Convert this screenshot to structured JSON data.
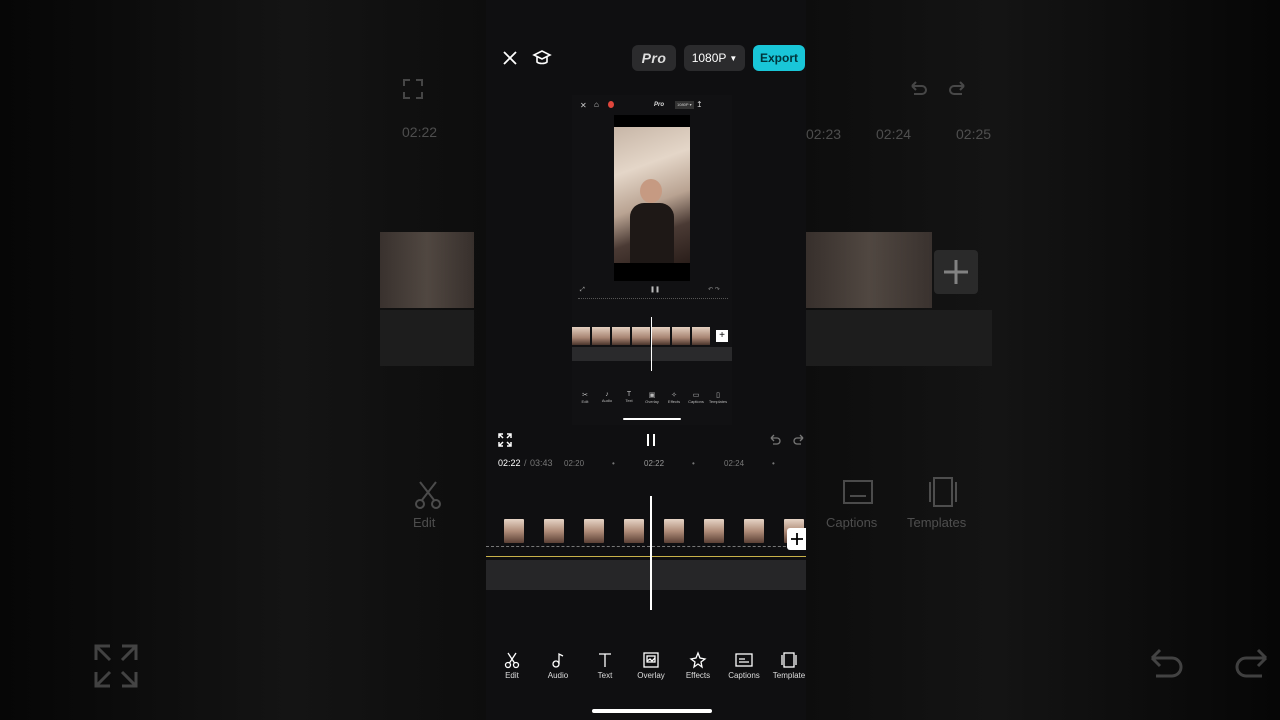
{
  "top_bar": {
    "close_label": "×",
    "pro_label": "Pro",
    "resolution_label": "1080P",
    "export_label": "Export"
  },
  "nested_preview": {
    "pro_label": "Pro",
    "resolution_label": "1080P"
  },
  "playback": {
    "current_time": "02:22",
    "separator": "/",
    "total_time": "03:43",
    "ticks": [
      "02:20",
      "02:22",
      "02:24"
    ]
  },
  "toolbar": {
    "items": [
      {
        "label": "Edit",
        "icon": "scissors-icon"
      },
      {
        "label": "Audio",
        "icon": "music-note-icon"
      },
      {
        "label": "Text",
        "icon": "text-icon"
      },
      {
        "label": "Overlay",
        "icon": "overlay-icon"
      },
      {
        "label": "Effects",
        "icon": "sparkle-icon"
      },
      {
        "label": "Captions",
        "icon": "captions-icon"
      },
      {
        "label": "Template",
        "icon": "template-icon"
      }
    ]
  },
  "nested_toolbar": {
    "items": [
      "Edit",
      "Audio",
      "Text",
      "Overlay",
      "Effects",
      "Captions",
      "Templates"
    ]
  },
  "background_left": {
    "time": "02:22",
    "edit_label": "Edit"
  },
  "background_right": {
    "ticks": [
      "02:23",
      "02:24",
      "02:25"
    ],
    "captions_label": "Captions",
    "templates_label": "Templates"
  },
  "colors": {
    "accent": "#19c6d8",
    "background": "#0f0f11"
  }
}
